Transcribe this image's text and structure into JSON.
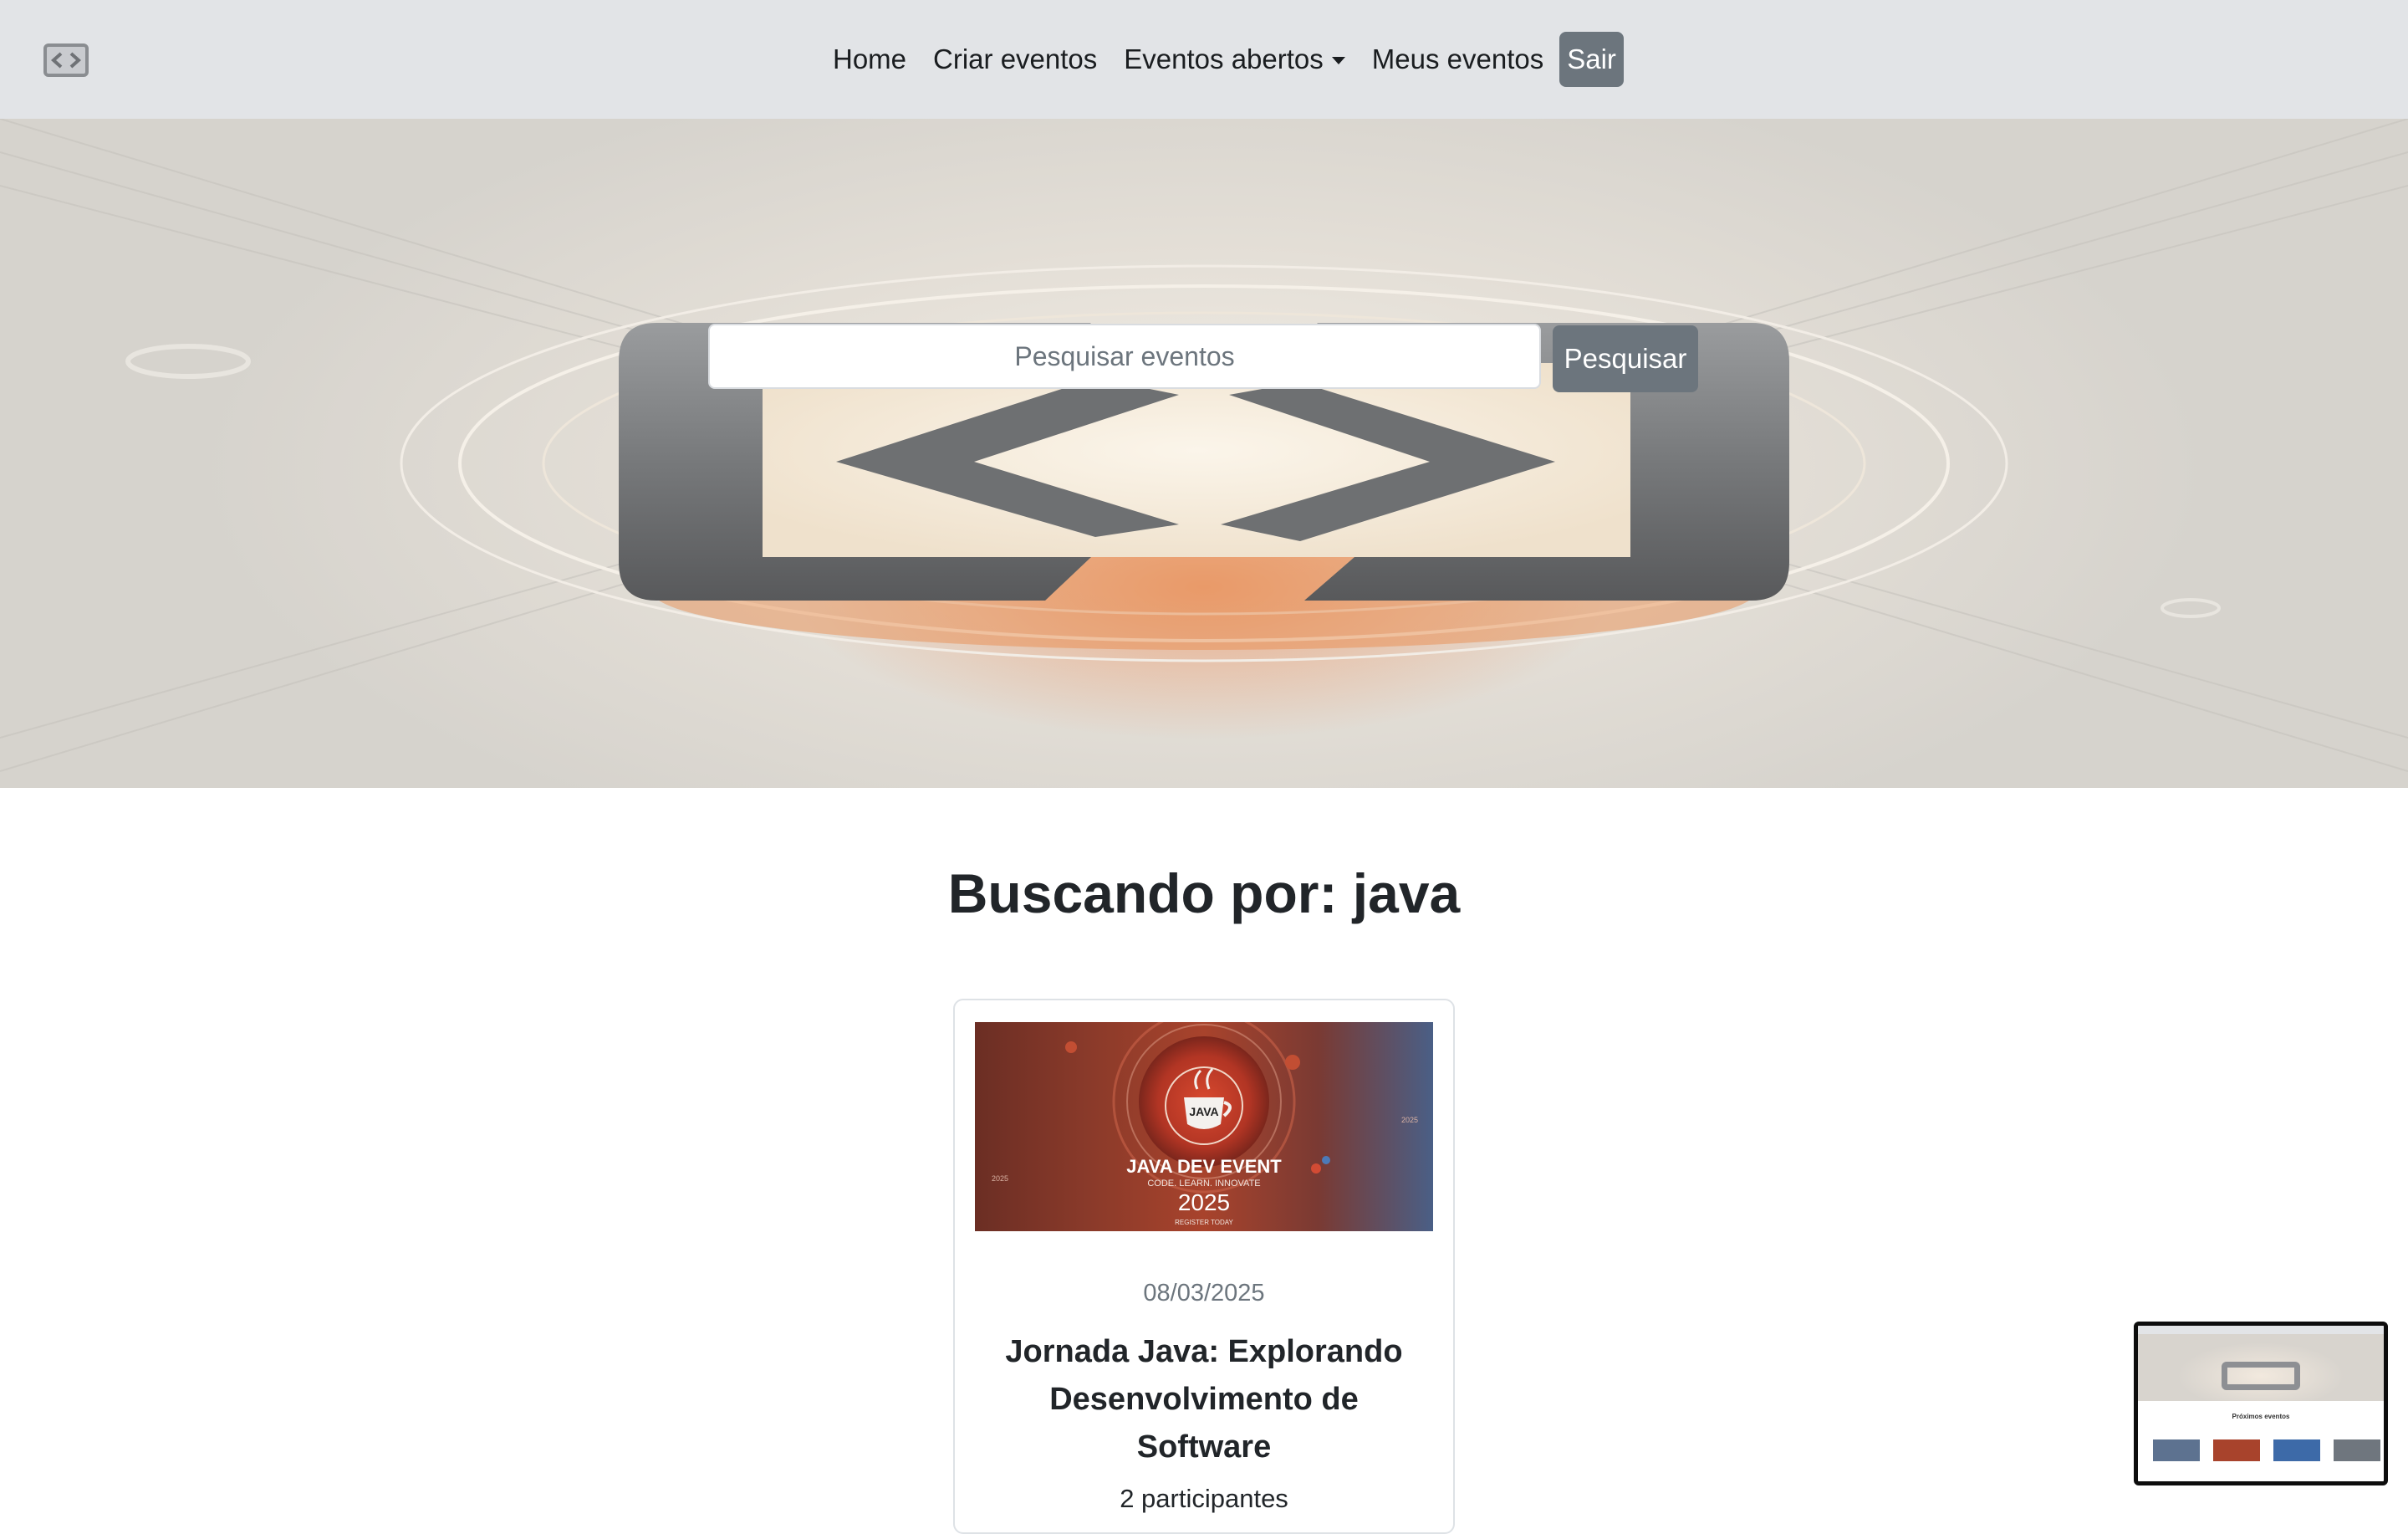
{
  "nav": {
    "logo_icon": "code-brackets-logo-icon",
    "links": [
      {
        "label": "Home"
      },
      {
        "label": "Criar eventos"
      },
      {
        "label": "Eventos abertos",
        "dropdown": true
      },
      {
        "label": "Meus eventos"
      }
    ],
    "logout_label": "Sair"
  },
  "hero": {
    "search_placeholder": "Pesquisar eventos",
    "search_button": "Pesquisar"
  },
  "results": {
    "heading": "Buscando por: java",
    "cards": [
      {
        "image_text": {
          "title": "JAVA DEV EVENT",
          "tagline": "CODE. LEARN. INNOVATE",
          "year": "2025",
          "cta": "REGISTER TODAY",
          "badge": "JAVA"
        },
        "date": "08/03/2025",
        "title": "Jornada Java: Explorando Desenvolvimento de Software",
        "participants": "2 participantes"
      }
    ]
  },
  "preview": {
    "title": "Próximos eventos"
  },
  "colors": {
    "navbar_bg": "#e2e4e7",
    "secondary_button": "#6c757d",
    "text_dark": "#212529",
    "muted": "#6c757d"
  }
}
